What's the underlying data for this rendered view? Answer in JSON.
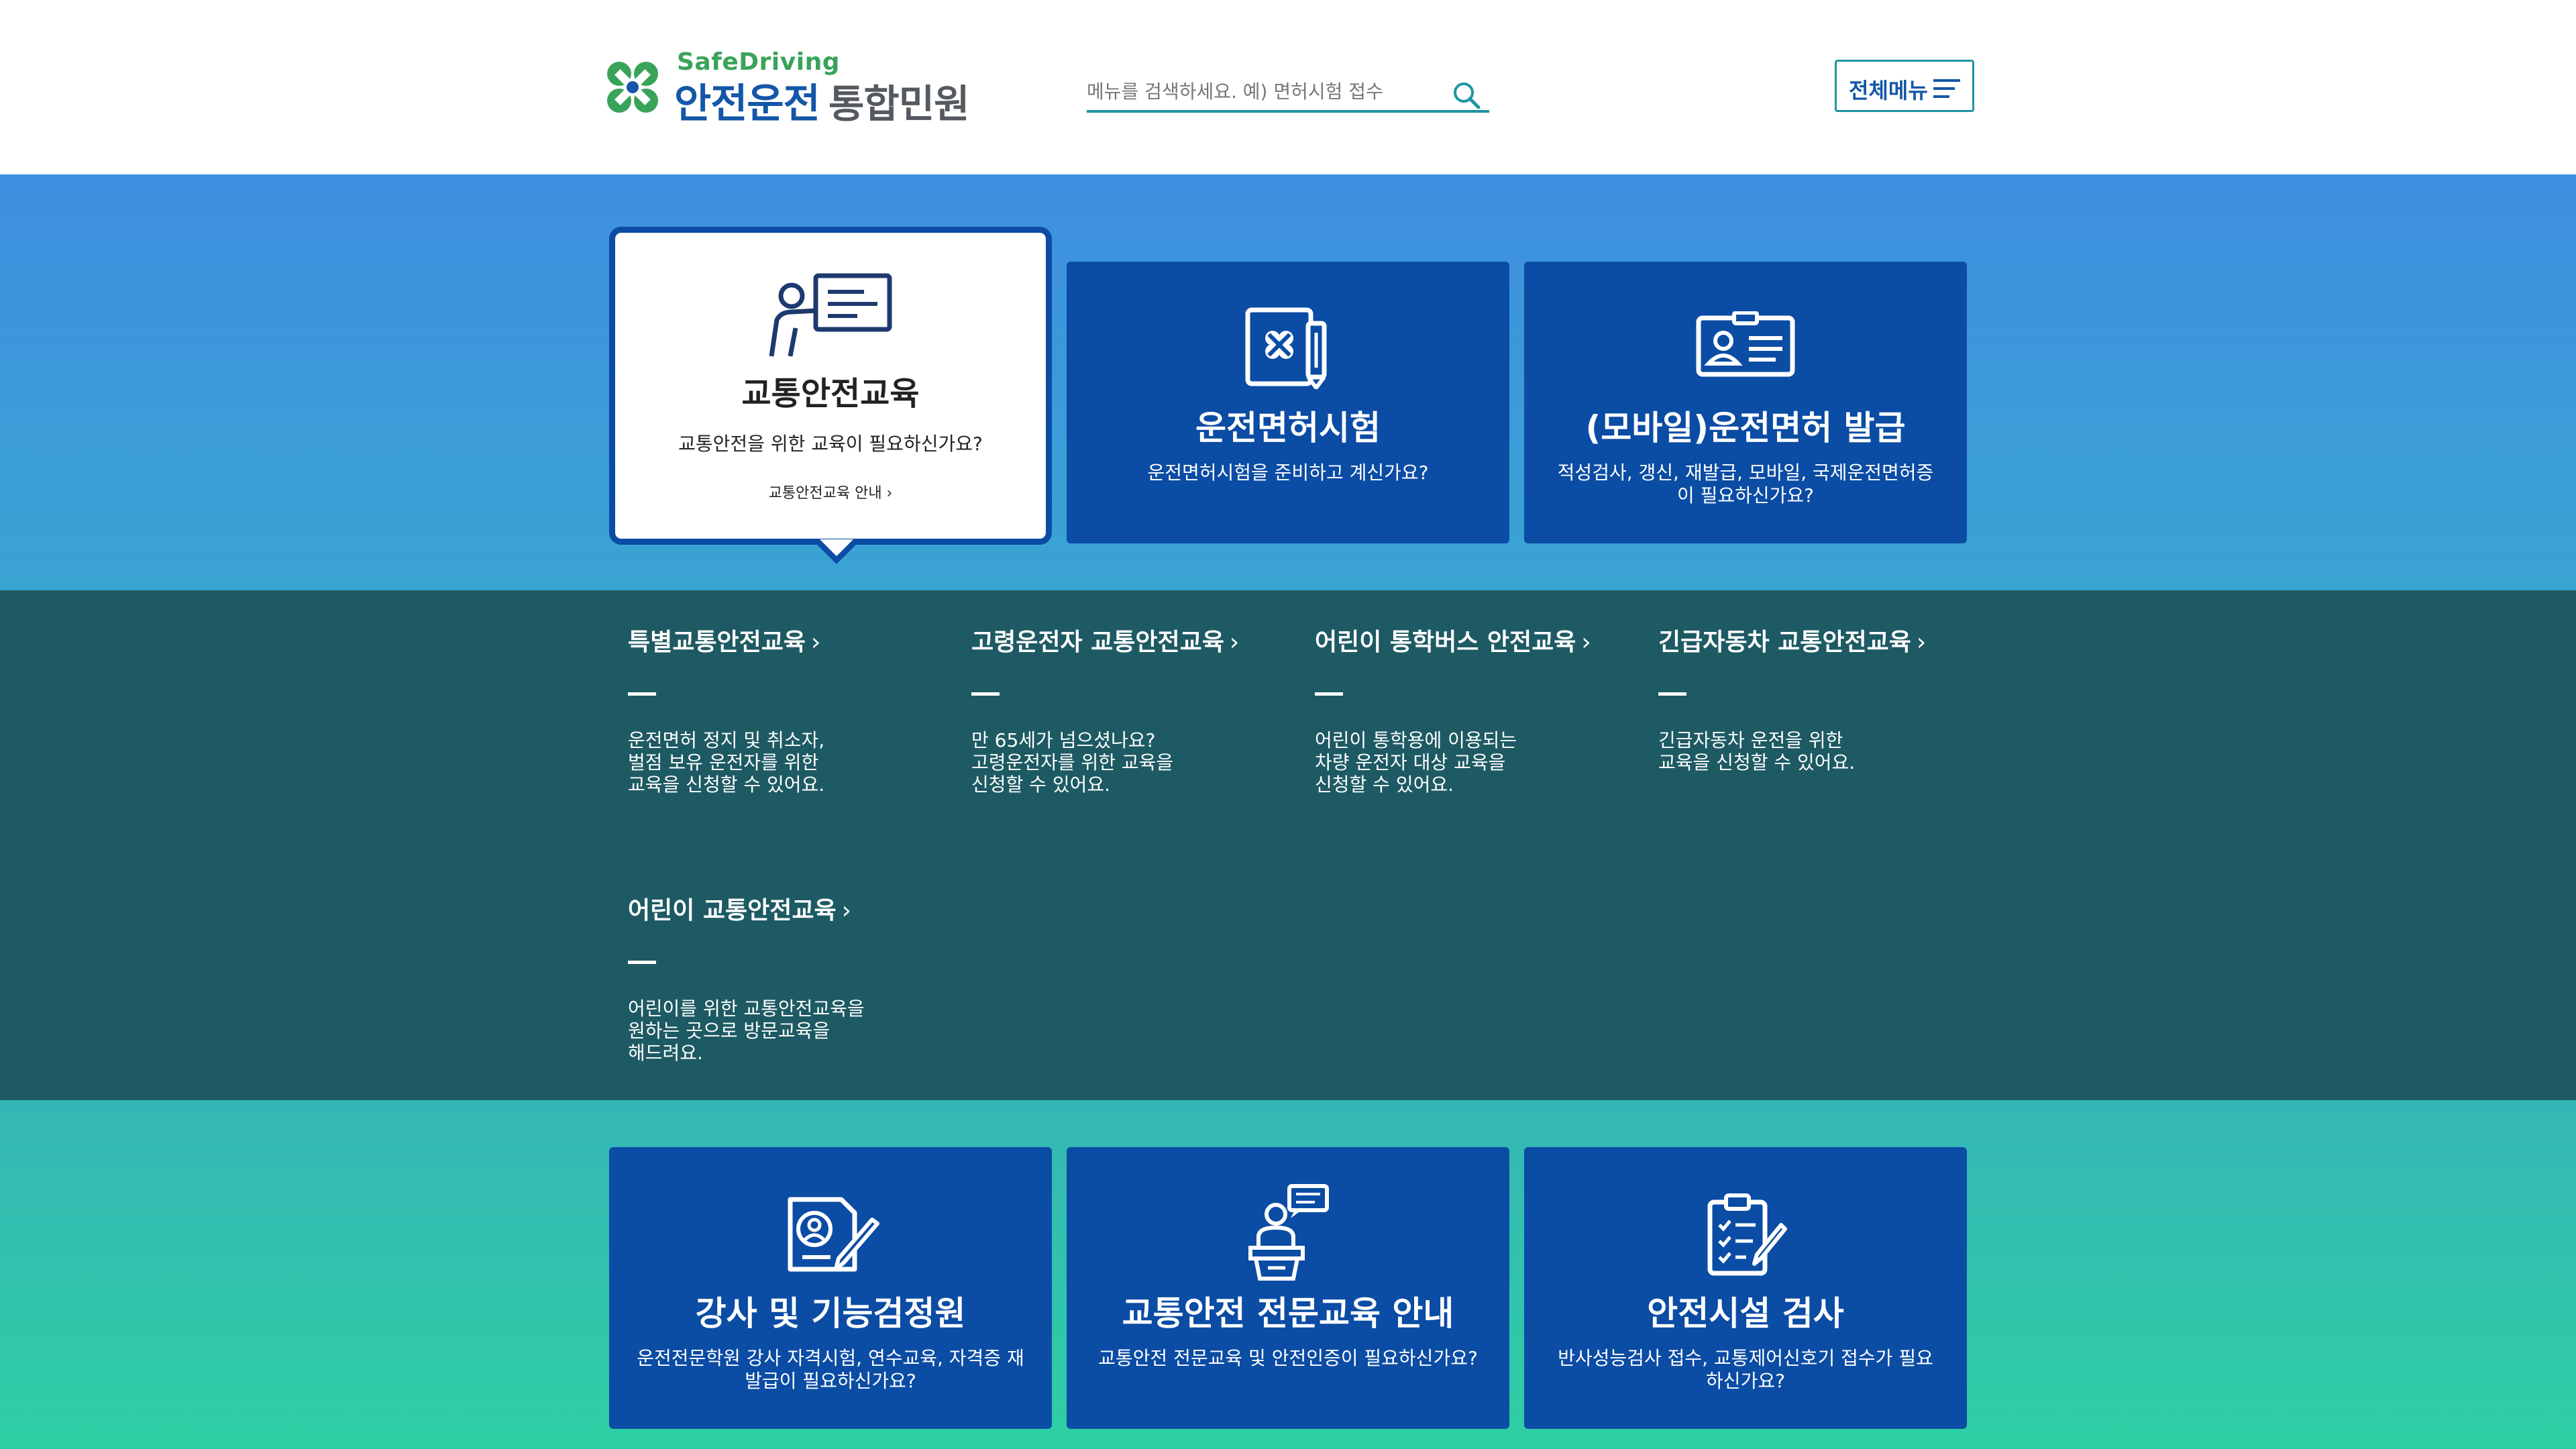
{
  "header": {
    "logo_small": "SafeDriving",
    "logo_main": "안전운전",
    "logo_sub": "통합민원",
    "search_placeholder": "메뉴를 검색하세요. 예) 면허시험 접수",
    "menu_label": "전체메뉴"
  },
  "main_cards": [
    {
      "title": "교통안전교육",
      "desc": "교통안전을 위한 교육이 필요하신가요?",
      "link": "교통안전교육 안내 ›",
      "icon": "teacher-board-icon",
      "active": true
    },
    {
      "title": "운전면허시험",
      "desc": "운전면허시험을 준비하고 계신가요?",
      "icon": "license-exam-icon"
    },
    {
      "title": "(모바일)운전면허 발급",
      "desc": "적성검사, 갱신, 재발급, 모바일, 국제운전면허증이 필요하신가요?",
      "icon": "id-card-icon"
    }
  ],
  "sub_items": [
    {
      "title": "특별교통안전교육",
      "desc": "운전면허 정지 및 취소자,\n벌점 보유 운전자를 위한\n교육을 신청할 수 있어요."
    },
    {
      "title": "고령운전자 교통안전교육",
      "desc": "만 65세가 넘으셨나요?\n고령운전자를 위한 교육을\n신청할 수 있어요."
    },
    {
      "title": "어린이 통학버스 안전교육",
      "desc": "어린이 통학용에 이용되는\n차량 운전자 대상 교육을\n신청할 수 있어요."
    },
    {
      "title": "긴급자동차 교통안전교육",
      "desc": "긴급자동차 운전을 위한\n교육을 신청할 수 있어요."
    },
    {
      "title": "어린이 교통안전교육",
      "desc": "어린이를 위한 교통안전교육을\n원하는 곳으로 방문교육을\n해드려요."
    }
  ],
  "bottom_cards": [
    {
      "title": "강사 및 기능검정원",
      "desc": "운전전문학원 강사 자격시험, 연수교육, 자격증 재발급이 필요하신가요?",
      "icon": "instructor-certificate-icon"
    },
    {
      "title": "교통안전 전문교육 안내",
      "desc": "교통안전 전문교육 및 안전인증이 필요하신가요?",
      "icon": "lecturer-podium-icon"
    },
    {
      "title": "안전시설 검사",
      "desc": "반사성능검사 접수, 교통제어신호기 접수가 필요하신가요?",
      "icon": "clipboard-checklist-icon"
    }
  ],
  "colors": {
    "primary": "#0b4ca4",
    "accent": "#1f96a0",
    "logo_green": "#3aa35a",
    "band_dark": "#1e5a63"
  }
}
